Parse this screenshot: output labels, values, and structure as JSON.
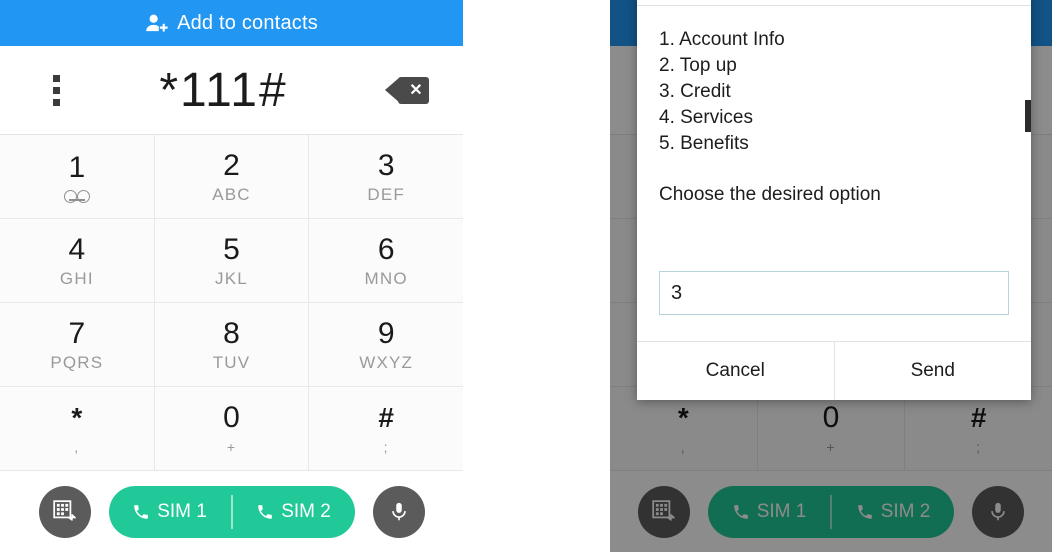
{
  "dialer": {
    "banner": {
      "label": "Add to contacts",
      "icon": "person-add-icon",
      "color": "#2196f3"
    },
    "overflow_icon": "overflow-menu-icon",
    "dialed_number": "*111#",
    "backspace_icon": "backspace-icon",
    "keys": [
      {
        "digit": "1",
        "sub": "",
        "icon": "voicemail-icon"
      },
      {
        "digit": "2",
        "sub": "ABC",
        "icon": ""
      },
      {
        "digit": "3",
        "sub": "DEF",
        "icon": ""
      },
      {
        "digit": "4",
        "sub": "GHI",
        "icon": ""
      },
      {
        "digit": "5",
        "sub": "JKL",
        "icon": ""
      },
      {
        "digit": "6",
        "sub": "MNO",
        "icon": ""
      },
      {
        "digit": "7",
        "sub": "PQRS",
        "icon": ""
      },
      {
        "digit": "8",
        "sub": "TUV",
        "icon": ""
      },
      {
        "digit": "9",
        "sub": "WXYZ",
        "icon": ""
      },
      {
        "digit": "*",
        "sub": ",",
        "icon": ""
      },
      {
        "digit": "0",
        "sub": "+",
        "icon": ""
      },
      {
        "digit": "#",
        "sub": ";",
        "icon": ""
      }
    ],
    "actions": {
      "keypad_toggle_icon": "keypad-hide-icon",
      "sim1_label": "SIM 1",
      "sim2_label": "SIM 2",
      "call_icon": "phone-icon",
      "mic_icon": "microphone-icon",
      "call_color": "#20c997"
    }
  },
  "ussd_dialog": {
    "faint_header": "",
    "menu": [
      "1. Account Info",
      "2. Top up",
      "3. Credit",
      "4. Services",
      "5. Benefits"
    ],
    "prompt": "Choose the desired option",
    "input_value": "3",
    "input_placeholder": "",
    "cancel_label": "Cancel",
    "send_label": "Send"
  }
}
